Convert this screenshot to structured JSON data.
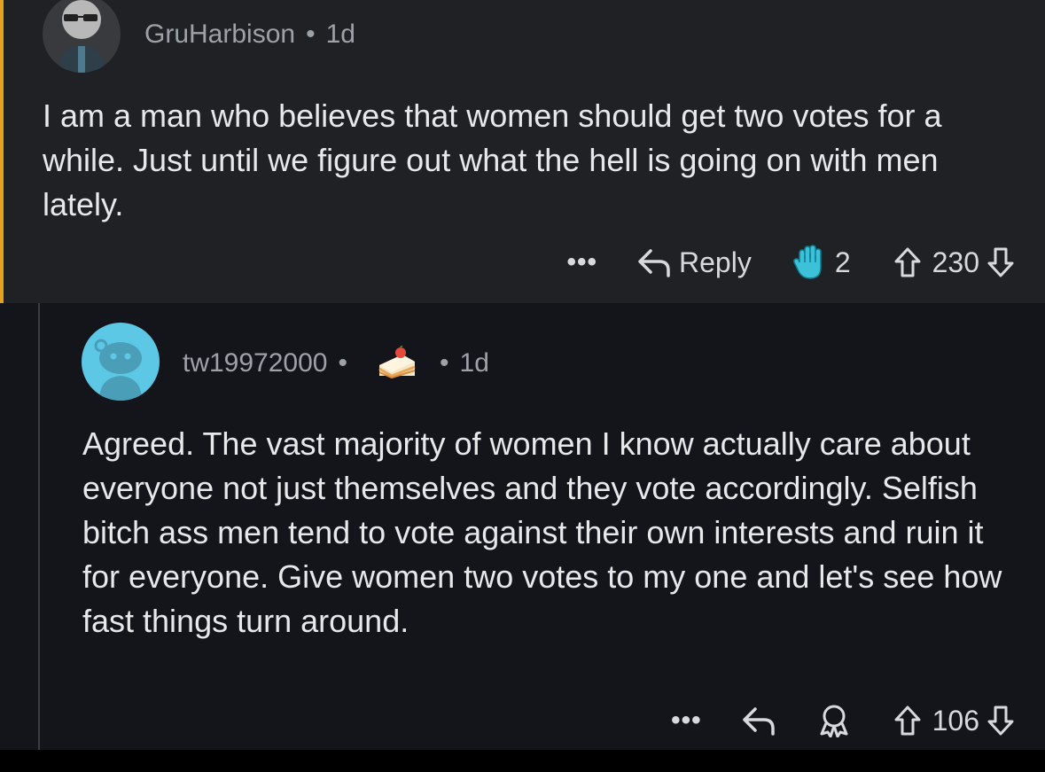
{
  "comments": [
    {
      "username": "GruHarbison",
      "age": "1d",
      "body": "I am a man who believes that women should get two votes for a while.  Just until we figure out what the hell is going on with men lately.",
      "actions": {
        "more_label": "•••",
        "reply_label": "Reply",
        "award_count": "2",
        "vote_score": "230"
      },
      "avatar_color": "#393a3e"
    },
    {
      "username": "tw19972000",
      "age": "1d",
      "body": "Agreed.  The vast majority of women I know actually care about everyone not just themselves and they vote accordingly. Selfish bitch ass men tend to vote against their own interests and ruin it for everyone.  Give women two votes to my one and let's see how fast things turn around.",
      "actions": {
        "more_label": "•••",
        "vote_score": "106"
      },
      "avatar_color": "#5cc8e6"
    }
  ],
  "separator": "•",
  "colors": {
    "comment1_bg": "#202125",
    "comment2_bg": "#13151b",
    "accent": "#e3a11f"
  },
  "icons": [
    "avatar-icon",
    "reply-arrow-icon",
    "award-icon",
    "upvote-icon",
    "downvote-icon",
    "cake-day-icon",
    "award-outline-icon"
  ]
}
